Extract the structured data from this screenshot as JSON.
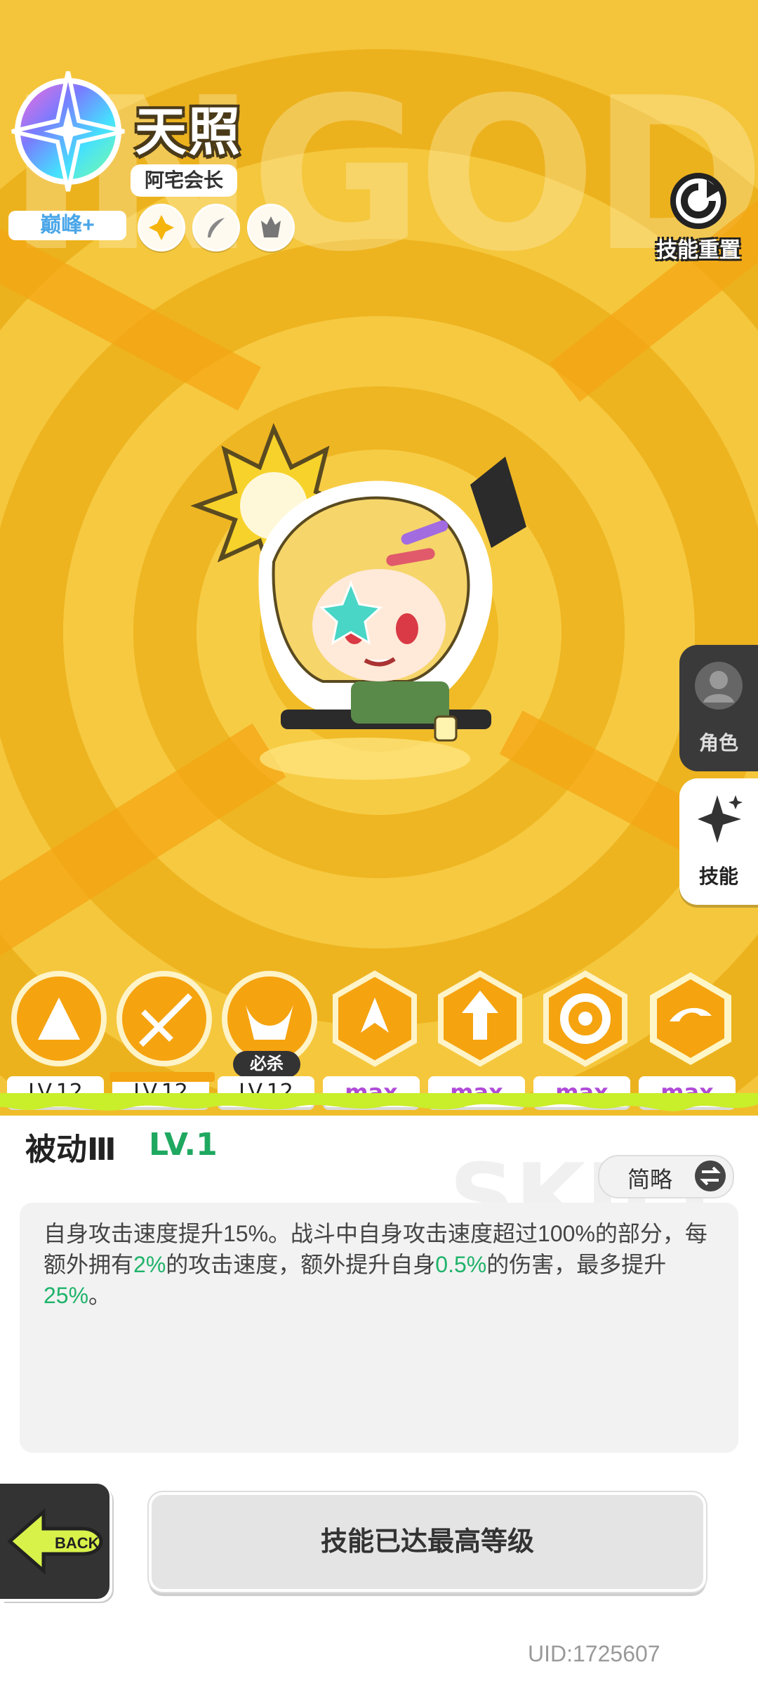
{
  "character": {
    "name": "天照",
    "title": "阿宅会长",
    "rank": "巅峰+",
    "background_text": "INGOD"
  },
  "header": {
    "reset_label": "技能重置"
  },
  "side_tabs": [
    {
      "label": "角色",
      "active": false
    },
    {
      "label": "技能",
      "active": true
    }
  ],
  "skills": [
    {
      "level": "LV.12",
      "icon": "fan-icon"
    },
    {
      "level": "LV.12",
      "icon": "sword-slash-icon",
      "selected": true
    },
    {
      "level": "LV.12",
      "icon": "claw-icon",
      "tag": "必杀"
    },
    {
      "level": "max",
      "icon": "burst-icon"
    },
    {
      "level": "max",
      "icon": "arrow-up-icon"
    },
    {
      "level": "max",
      "icon": "vortex-icon"
    },
    {
      "level": "max",
      "icon": "spin-icon"
    }
  ],
  "detail": {
    "name": "被动Ⅲ",
    "level": "LV.1",
    "toggle_label": "简略",
    "watermark": "SKILL",
    "description_parts": [
      {
        "text": "自身攻击速度提升15%。战斗中自身攻击速度超过100%的部分，每额外拥有",
        "highlight": false
      },
      {
        "text": "2%",
        "highlight": true
      },
      {
        "text": "的攻击速度，额外提升自身",
        "highlight": false
      },
      {
        "text": "0.5%",
        "highlight": true
      },
      {
        "text": "的伤害，最多提升",
        "highlight": false
      },
      {
        "text": "25%",
        "highlight": true
      },
      {
        "text": "。",
        "highlight": false
      }
    ]
  },
  "footer": {
    "back_label": "BACK",
    "max_button_label": "技能已达最高等级",
    "uid": "UID:1725607"
  },
  "colors": {
    "background": "#f0bd2a",
    "highlight_green": "#1fb36a",
    "max_purple": "#b04ad8",
    "slime_green": "#c9ee2a"
  }
}
